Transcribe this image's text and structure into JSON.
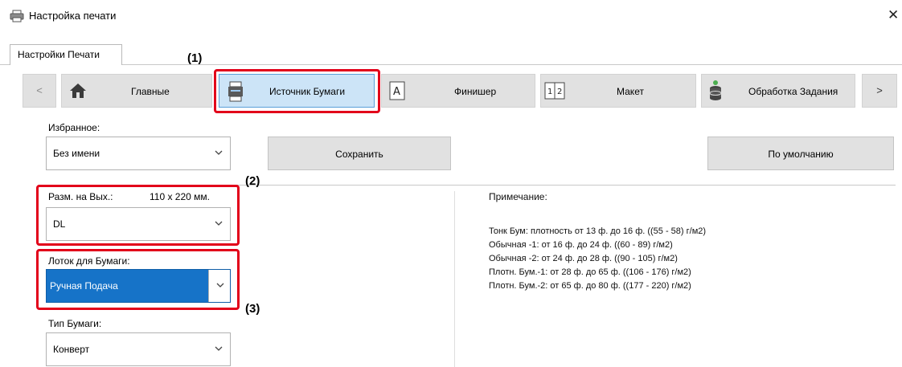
{
  "window": {
    "title": "Настройка печати",
    "close_glyph": "✕"
  },
  "tabs": [
    {
      "label": "Настройки Печати"
    }
  ],
  "ribbon": {
    "prev_glyph": "<",
    "next_glyph": ">",
    "items": [
      {
        "label": "Главные",
        "icon": "home-icon"
      },
      {
        "label": "Источник Бумаги",
        "icon": "paper-source-icon"
      },
      {
        "label": "Финишер",
        "icon": "finisher-icon"
      },
      {
        "label": "Макет",
        "icon": "layout-icon"
      },
      {
        "label": "Обработка Задания",
        "icon": "job-handling-icon"
      }
    ],
    "selected": "Источник Бумаги"
  },
  "favorites": {
    "label": "Избранное:",
    "value": "Без имени",
    "save_label": "Сохранить",
    "default_label": "По умолчанию"
  },
  "output_size": {
    "label": "Разм. на Вых.:",
    "dimensions": "110 x 220 мм.",
    "value": "DL"
  },
  "paper_tray": {
    "label": "Лоток для Бумаги:",
    "value": "Ручная Подача"
  },
  "paper_type": {
    "label": "Тип Бумаги:",
    "value": "Конверт"
  },
  "note": {
    "title": "Примечание:",
    "lines": [
      "Тонк Бум: плотность от 13 ф. до 16 ф. ((55 - 58) г/м2)",
      "Обычная -1: от 16 ф. до 24 ф. ((60 - 89) г/м2)",
      "Обычная -2: от 24 ф. до 28 ф. ((90 - 105) г/м2)",
      "Плотн. Бум.-1: от 28 ф. до 65 ф. ((106 - 176) г/м2)",
      "Плотн. Бум.-2: от 65 ф. до 80 ф. ((177 - 220) г/м2)"
    ]
  },
  "callouts": [
    "(1)",
    "(2)",
    "(3)"
  ],
  "colors": {
    "highlight_red": "#e2001a",
    "selected_blue": "#1673c8",
    "ribbon_selected": "#cce4f7"
  }
}
